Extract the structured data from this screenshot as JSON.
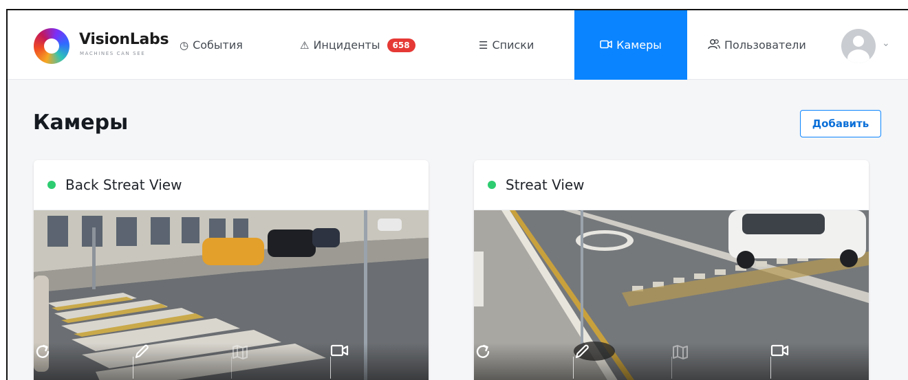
{
  "brand": {
    "name": "VisionLabs",
    "tagline": "MACHINES CAN SEE"
  },
  "nav": {
    "items": [
      {
        "label": "События",
        "icon": "clock-icon"
      },
      {
        "label": "Инциденты",
        "icon": "warning-icon",
        "badge": "658"
      },
      {
        "label": "Списки",
        "icon": "list-icon"
      },
      {
        "label": "Камеры",
        "icon": "camera-icon",
        "active": true
      },
      {
        "label": "Пользователи",
        "icon": "users-icon"
      }
    ],
    "avatar_icon": "user-avatar-icon"
  },
  "page": {
    "title": "Камеры",
    "add_label": "Добавить"
  },
  "cameras": [
    {
      "name": "Back Streat View",
      "status": "online",
      "status_color": "#2ecc71"
    },
    {
      "name": "Streat View",
      "status": "online",
      "status_color": "#2ecc71"
    }
  ],
  "card_tools": [
    "refresh-icon",
    "edit-pencil-icon",
    "map-icon",
    "video-camera-icon"
  ],
  "colors": {
    "accent": "#0a84ff",
    "badge": "#e53935",
    "online": "#2ecc71"
  }
}
